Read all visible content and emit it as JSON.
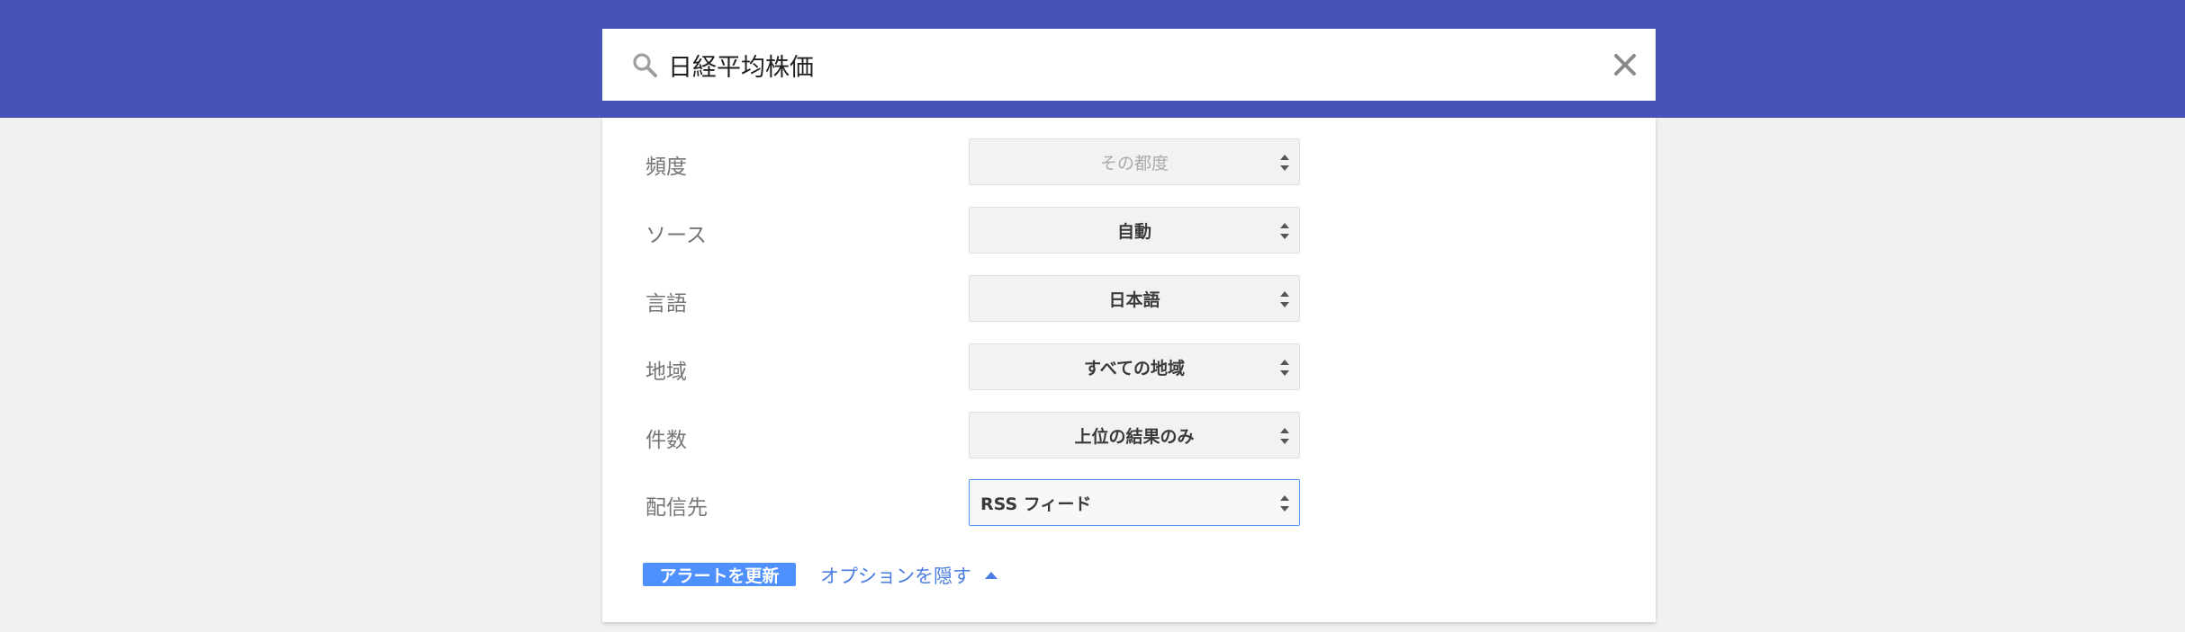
{
  "search": {
    "query": "日経平均株価",
    "icon": "search-icon",
    "clear_icon": "close-icon"
  },
  "options": [
    {
      "label": "頻度",
      "value": "その都度",
      "state": "disabled"
    },
    {
      "label": "ソース",
      "value": "自動",
      "state": "normal"
    },
    {
      "label": "言語",
      "value": "日本語",
      "state": "normal"
    },
    {
      "label": "地域",
      "value": "すべての地域",
      "state": "normal"
    },
    {
      "label": "件数",
      "value": "上位の結果のみ",
      "state": "normal"
    },
    {
      "label": "配信先",
      "value": "RSS フィード",
      "state": "focused"
    }
  ],
  "actions": {
    "update_label": "アラートを更新",
    "hide_options_label": "オプションを隠す"
  },
  "colors": {
    "header": "#4652b5",
    "accent": "#4d90fe",
    "link": "#4a7de2",
    "background": "#f1f1f1"
  }
}
